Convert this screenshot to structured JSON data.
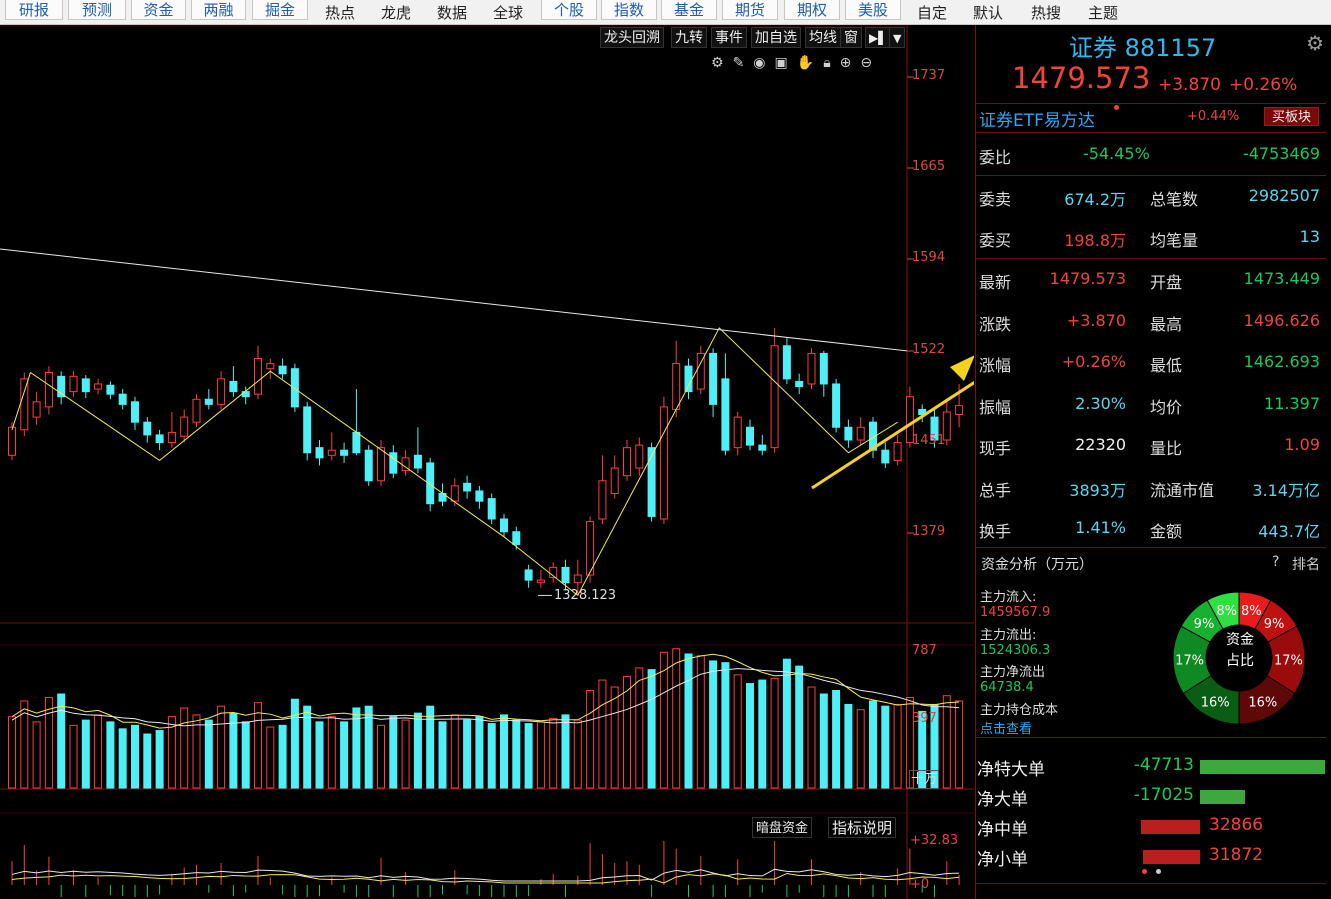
{
  "toolbar": {
    "buttons": [
      "研报",
      "预测",
      "资金",
      "两融",
      "掘金"
    ],
    "texts": [
      "热点",
      "龙虎",
      "数据",
      "全球"
    ],
    "buttons2": [
      "个股",
      "指数",
      "基金",
      "期货",
      "期权",
      "美股"
    ],
    "texts2": [
      "自定",
      "默认",
      "热搜",
      "主题"
    ]
  },
  "chart_controls": [
    "龙头回溯",
    "九转",
    "事件",
    "加自选",
    "均线",
    "窗"
  ],
  "price_axis": [
    "1737",
    "1665",
    "1594",
    "1522",
    "1451",
    "1379"
  ],
  "low_marker": "1328.123",
  "volume_axis": [
    "787",
    "397"
  ],
  "volume_unit": "十万",
  "indicator_axis": [
    "+32.83",
    "+0"
  ],
  "indicator_buttons": [
    "暗盘资金",
    "指标说明"
  ],
  "chart_data": {
    "type": "candlestick",
    "ylim": [
      1320,
      1760
    ],
    "candles": [
      {
        "o": 1440,
        "c": 1462,
        "h": 1466,
        "l": 1436
      },
      {
        "o": 1460,
        "c": 1500,
        "h": 1505,
        "l": 1455
      },
      {
        "o": 1470,
        "c": 1482,
        "h": 1490,
        "l": 1464
      },
      {
        "o": 1478,
        "c": 1505,
        "h": 1510,
        "l": 1472
      },
      {
        "o": 1502,
        "c": 1486,
        "h": 1506,
        "l": 1480
      },
      {
        "o": 1490,
        "c": 1502,
        "h": 1506,
        "l": 1486
      },
      {
        "o": 1500,
        "c": 1490,
        "h": 1503,
        "l": 1485
      },
      {
        "o": 1492,
        "c": 1496,
        "h": 1500,
        "l": 1488
      },
      {
        "o": 1495,
        "c": 1488,
        "h": 1498,
        "l": 1484
      },
      {
        "o": 1488,
        "c": 1480,
        "h": 1492,
        "l": 1476
      },
      {
        "o": 1482,
        "c": 1466,
        "h": 1486,
        "l": 1460
      },
      {
        "o": 1466,
        "c": 1456,
        "h": 1470,
        "l": 1450
      },
      {
        "o": 1456,
        "c": 1450,
        "h": 1460,
        "l": 1444
      },
      {
        "o": 1450,
        "c": 1458,
        "h": 1474,
        "l": 1446
      },
      {
        "o": 1455,
        "c": 1470,
        "h": 1476,
        "l": 1450
      },
      {
        "o": 1466,
        "c": 1484,
        "h": 1488,
        "l": 1462
      },
      {
        "o": 1484,
        "c": 1480,
        "h": 1492,
        "l": 1476
      },
      {
        "o": 1480,
        "c": 1500,
        "h": 1506,
        "l": 1476
      },
      {
        "o": 1498,
        "c": 1490,
        "h": 1510,
        "l": 1486
      },
      {
        "o": 1490,
        "c": 1486,
        "h": 1494,
        "l": 1480
      },
      {
        "o": 1488,
        "c": 1516,
        "h": 1526,
        "l": 1484
      },
      {
        "o": 1508,
        "c": 1512,
        "h": 1516,
        "l": 1500
      },
      {
        "o": 1510,
        "c": 1504,
        "h": 1516,
        "l": 1500
      },
      {
        "o": 1508,
        "c": 1478,
        "h": 1512,
        "l": 1474
      },
      {
        "o": 1478,
        "c": 1442,
        "h": 1482,
        "l": 1436
      },
      {
        "o": 1446,
        "c": 1438,
        "h": 1452,
        "l": 1432
      },
      {
        "o": 1440,
        "c": 1444,
        "h": 1458,
        "l": 1436
      },
      {
        "o": 1444,
        "c": 1440,
        "h": 1450,
        "l": 1434
      },
      {
        "o": 1458,
        "c": 1442,
        "h": 1492,
        "l": 1440
      },
      {
        "o": 1444,
        "c": 1420,
        "h": 1448,
        "l": 1416
      },
      {
        "o": 1420,
        "c": 1446,
        "h": 1452,
        "l": 1416
      },
      {
        "o": 1442,
        "c": 1426,
        "h": 1448,
        "l": 1422
      },
      {
        "o": 1428,
        "c": 1438,
        "h": 1444,
        "l": 1424
      },
      {
        "o": 1440,
        "c": 1430,
        "h": 1462,
        "l": 1426
      },
      {
        "o": 1434,
        "c": 1402,
        "h": 1438,
        "l": 1396
      },
      {
        "o": 1410,
        "c": 1404,
        "h": 1418,
        "l": 1400
      },
      {
        "o": 1404,
        "c": 1416,
        "h": 1422,
        "l": 1400
      },
      {
        "o": 1418,
        "c": 1412,
        "h": 1424,
        "l": 1406
      },
      {
        "o": 1412,
        "c": 1404,
        "h": 1416,
        "l": 1398
      },
      {
        "o": 1406,
        "c": 1390,
        "h": 1410,
        "l": 1386
      },
      {
        "o": 1390,
        "c": 1380,
        "h": 1394,
        "l": 1376
      },
      {
        "o": 1380,
        "c": 1370,
        "h": 1384,
        "l": 1366
      },
      {
        "o": 1350,
        "c": 1342,
        "h": 1354,
        "l": 1336
      },
      {
        "o": 1340,
        "c": 1342,
        "h": 1350,
        "l": 1336
      },
      {
        "o": 1344,
        "c": 1352,
        "h": 1356,
        "l": 1340
      },
      {
        "o": 1352,
        "c": 1340,
        "h": 1358,
        "l": 1334
      },
      {
        "o": 1340,
        "c": 1346,
        "h": 1358,
        "l": 1330
      },
      {
        "o": 1346,
        "c": 1388,
        "h": 1392,
        "l": 1340
      },
      {
        "o": 1390,
        "c": 1420,
        "h": 1440,
        "l": 1386
      },
      {
        "o": 1410,
        "c": 1430,
        "h": 1440,
        "l": 1406
      },
      {
        "o": 1424,
        "c": 1446,
        "h": 1452,
        "l": 1420
      },
      {
        "o": 1430,
        "c": 1448,
        "h": 1454,
        "l": 1424
      },
      {
        "o": 1446,
        "c": 1392,
        "h": 1450,
        "l": 1388
      },
      {
        "o": 1390,
        "c": 1478,
        "h": 1486,
        "l": 1386
      },
      {
        "o": 1476,
        "c": 1512,
        "h": 1530,
        "l": 1470
      },
      {
        "o": 1510,
        "c": 1490,
        "h": 1516,
        "l": 1484
      },
      {
        "o": 1492,
        "c": 1520,
        "h": 1526,
        "l": 1488
      },
      {
        "o": 1520,
        "c": 1480,
        "h": 1524,
        "l": 1470
      },
      {
        "o": 1500,
        "c": 1444,
        "h": 1520,
        "l": 1440
      },
      {
        "o": 1446,
        "c": 1470,
        "h": 1474,
        "l": 1440
      },
      {
        "o": 1462,
        "c": 1448,
        "h": 1468,
        "l": 1444
      },
      {
        "o": 1448,
        "c": 1444,
        "h": 1456,
        "l": 1440
      },
      {
        "o": 1446,
        "c": 1526,
        "h": 1540,
        "l": 1442
      },
      {
        "o": 1526,
        "c": 1500,
        "h": 1532,
        "l": 1496
      },
      {
        "o": 1498,
        "c": 1494,
        "h": 1504,
        "l": 1488
      },
      {
        "o": 1496,
        "c": 1520,
        "h": 1524,
        "l": 1492
      },
      {
        "o": 1520,
        "c": 1496,
        "h": 1522,
        "l": 1486
      },
      {
        "o": 1496,
        "c": 1462,
        "h": 1500,
        "l": 1458
      },
      {
        "o": 1462,
        "c": 1452,
        "h": 1468,
        "l": 1446
      },
      {
        "o": 1452,
        "c": 1462,
        "h": 1470,
        "l": 1448
      },
      {
        "o": 1466,
        "c": 1444,
        "h": 1470,
        "l": 1438
      },
      {
        "o": 1444,
        "c": 1434,
        "h": 1450,
        "l": 1430
      },
      {
        "o": 1436,
        "c": 1450,
        "h": 1456,
        "l": 1432
      },
      {
        "o": 1450,
        "c": 1486,
        "h": 1494,
        "l": 1446
      },
      {
        "o": 1476,
        "c": 1472,
        "h": 1480,
        "l": 1466
      },
      {
        "o": 1470,
        "c": 1452,
        "h": 1476,
        "l": 1446
      },
      {
        "o": 1452,
        "c": 1474,
        "h": 1484,
        "l": 1448
      },
      {
        "o": 1472,
        "c": 1479,
        "h": 1496,
        "l": 1462
      }
    ],
    "volumes": [
      410,
      500,
      380,
      520,
      540,
      360,
      390,
      420,
      380,
      340,
      360,
      310,
      330,
      410,
      460,
      420,
      390,
      470,
      430,
      380,
      490,
      350,
      360,
      510,
      470,
      380,
      410,
      380,
      460,
      470,
      360,
      410,
      390,
      430,
      470,
      380,
      420,
      390,
      410,
      370,
      420,
      390,
      370,
      380,
      400,
      420,
      390,
      560,
      620,
      580,
      640,
      690,
      680,
      780,
      800,
      770,
      760,
      730,
      720,
      650,
      600,
      620,
      630,
      740,
      700,
      580,
      540,
      560,
      480,
      450,
      500,
      470,
      480,
      520,
      440,
      480,
      530,
      500
    ],
    "zigzag": [
      [
        0,
        1460
      ],
      [
        3,
        1505
      ],
      [
        24,
        1436
      ],
      [
        42,
        1506
      ],
      [
        80,
        1376
      ],
      [
        92,
        1330
      ],
      [
        115,
        1540
      ],
      [
        136,
        1442
      ],
      [
        144,
        1466
      ]
    ],
    "trend_line": [
      [
        1520,
        1602
      ],
      [
        1450,
        1522
      ]
    ]
  },
  "panel": {
    "name_code": "证券 881157",
    "price": "1479.573",
    "change": "+3.870",
    "change_pct": "+0.26%",
    "etf_name": "证券ETF易方达",
    "etf_change": "+0.44%",
    "buy_block": "买板块",
    "weibi": {
      "label": "委比",
      "pct": "-54.45%",
      "val": "-4753469"
    },
    "rows": [
      {
        "l1": "委卖",
        "v1": "674.2万",
        "l2": "总笔数",
        "v2": "2982507",
        "c1": "cyan",
        "c2": "cyan"
      },
      {
        "l1": "委买",
        "v1": "198.8万",
        "l2": "均笔量",
        "v2": "13",
        "c1": "red",
        "c2": "cyan"
      },
      {
        "l1": "最新",
        "v1": "1479.573",
        "l2": "开盘",
        "v2": "1473.449",
        "c1": "red",
        "c2": "green"
      },
      {
        "l1": "涨跌",
        "v1": "+3.870",
        "l2": "最高",
        "v2": "1496.626",
        "c1": "red",
        "c2": "red"
      },
      {
        "l1": "涨幅",
        "v1": "+0.26%",
        "l2": "最低",
        "v2": "1462.693",
        "c1": "red",
        "c2": "green"
      },
      {
        "l1": "振幅",
        "v1": "2.30%",
        "l2": "均价",
        "v2": "11.397",
        "c1": "cyan",
        "c2": "green"
      },
      {
        "l1": "现手",
        "v1": "22320",
        "l2": "量比",
        "v2": "1.09",
        "c1": "white",
        "c2": "red"
      },
      {
        "l1": "总手",
        "v1": "3893万",
        "l2": "流通市值",
        "v2": "3.14万亿",
        "c1": "cyan",
        "c2": "cyan"
      },
      {
        "l1": "换手",
        "v1": "1.41%",
        "l2": "金额",
        "v2": "443.7亿",
        "c1": "cyan",
        "c2": "cyan"
      }
    ],
    "fund": {
      "title": "资金分析（万元）",
      "help": "?",
      "rank": "排名",
      "inflow_label": "主力流入:",
      "inflow": "1459567.9",
      "outflow_label": "主力流出:",
      "outflow": "1524306.3",
      "net_label": "主力净流出",
      "net": "64738.4",
      "cost_label": "主力持仓成本",
      "view": "点击查看",
      "donut_center": [
        "资金",
        "占比"
      ],
      "donut": [
        {
          "pct": "8%",
          "color": "#e81c1c"
        },
        {
          "pct": "9%",
          "color": "#c01010"
        },
        {
          "pct": "17%",
          "color": "#9a0c0c"
        },
        {
          "pct": "16%",
          "color": "#5e0808"
        },
        {
          "pct": "16%",
          "color": "#0a5e14"
        },
        {
          "pct": "17%",
          "color": "#0f8a22"
        },
        {
          "pct": "9%",
          "color": "#17b02f"
        },
        {
          "pct": "8%",
          "color": "#2ee040"
        }
      ]
    },
    "net_orders": [
      {
        "label": "净特大单",
        "value": "-47713",
        "amount": -47713
      },
      {
        "label": "净大单",
        "value": "-17025",
        "amount": -17025
      },
      {
        "label": "净中单",
        "value": "32866",
        "amount": 32866
      },
      {
        "label": "净小单",
        "value": "31872",
        "amount": 31872
      }
    ]
  }
}
